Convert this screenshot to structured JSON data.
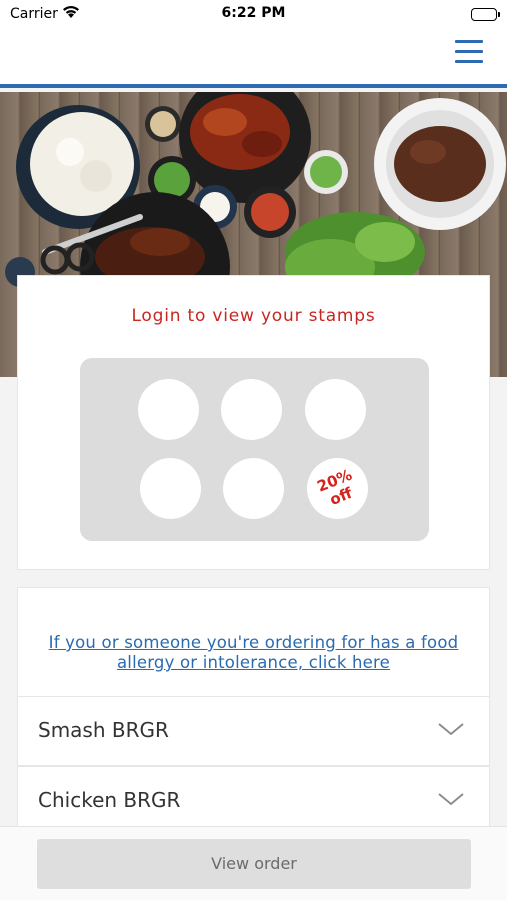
{
  "status_bar": {
    "carrier": "Carrier",
    "time": "6:22 PM"
  },
  "nav": {
    "menu_icon": "hamburger-menu-icon",
    "accent_color": "#2f6bb3"
  },
  "hero": {
    "image": "korean-bbq-food-spread"
  },
  "stamp_card": {
    "title": "Login to view your stamps",
    "title_color": "#c9261f",
    "stamps_total": 6,
    "reward_line1": "20%",
    "reward_line2": "off"
  },
  "allergy": {
    "link_line1": "If you or someone you're ordering for has a food",
    "link_line2": "allergy or intolerance, click here",
    "link_color": "#2a6ab0"
  },
  "menu": {
    "categories": [
      {
        "label": "Smash BRGR"
      },
      {
        "label": "Chicken BRGR"
      }
    ]
  },
  "footer": {
    "view_order_label": "View order"
  }
}
